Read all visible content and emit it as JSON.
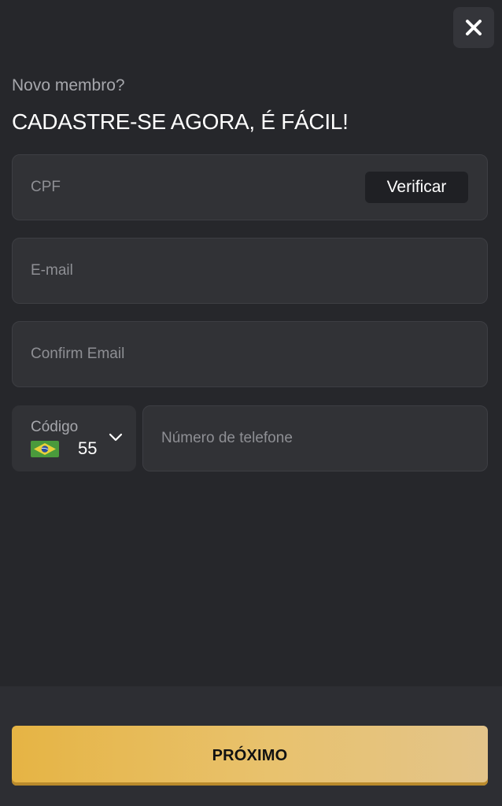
{
  "header": {
    "subtitle": "Novo membro?",
    "title": "CADASTRE-SE AGORA, É FÁCIL!",
    "close_icon": "close-icon"
  },
  "form": {
    "cpf": {
      "placeholder": "CPF",
      "value": ""
    },
    "verify_label": "Verificar",
    "email": {
      "placeholder": "E-mail",
      "value": ""
    },
    "confirm_email": {
      "placeholder": "Confirm Email",
      "value": ""
    },
    "country_code": {
      "label": "Código",
      "value": "55",
      "flag_icon": "brazil-flag-icon",
      "dropdown_icon": "chevron-down-icon"
    },
    "phone": {
      "placeholder": "Número de telefone",
      "value": ""
    }
  },
  "footer": {
    "next_label": "PRÓXIMO"
  },
  "colors": {
    "background": "#26272b",
    "field_background": "#313236",
    "accent": "#e6b444",
    "text_primary": "#ffffff",
    "text_muted": "#8e8f94"
  }
}
